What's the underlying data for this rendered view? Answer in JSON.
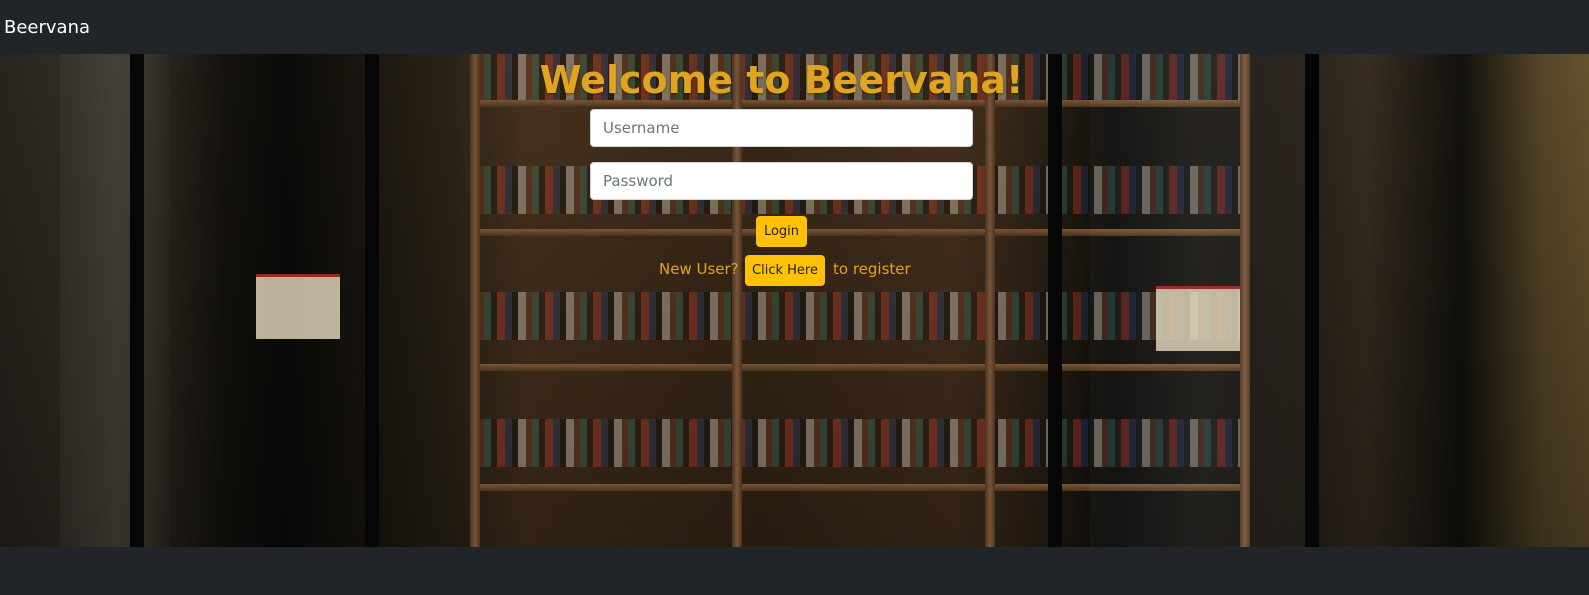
{
  "navbar": {
    "brand": "Beervana"
  },
  "login": {
    "title": "Welcome to Beervana!",
    "username_placeholder": "Username",
    "password_placeholder": "Password",
    "username_value": "",
    "password_value": "",
    "login_label": "Login"
  },
  "register": {
    "prefix": "New User?",
    "button_label": "Click Here",
    "suffix": "to register"
  },
  "colors": {
    "navbar": "#212529",
    "accent": "#ffc107",
    "title": "#e0a420"
  }
}
